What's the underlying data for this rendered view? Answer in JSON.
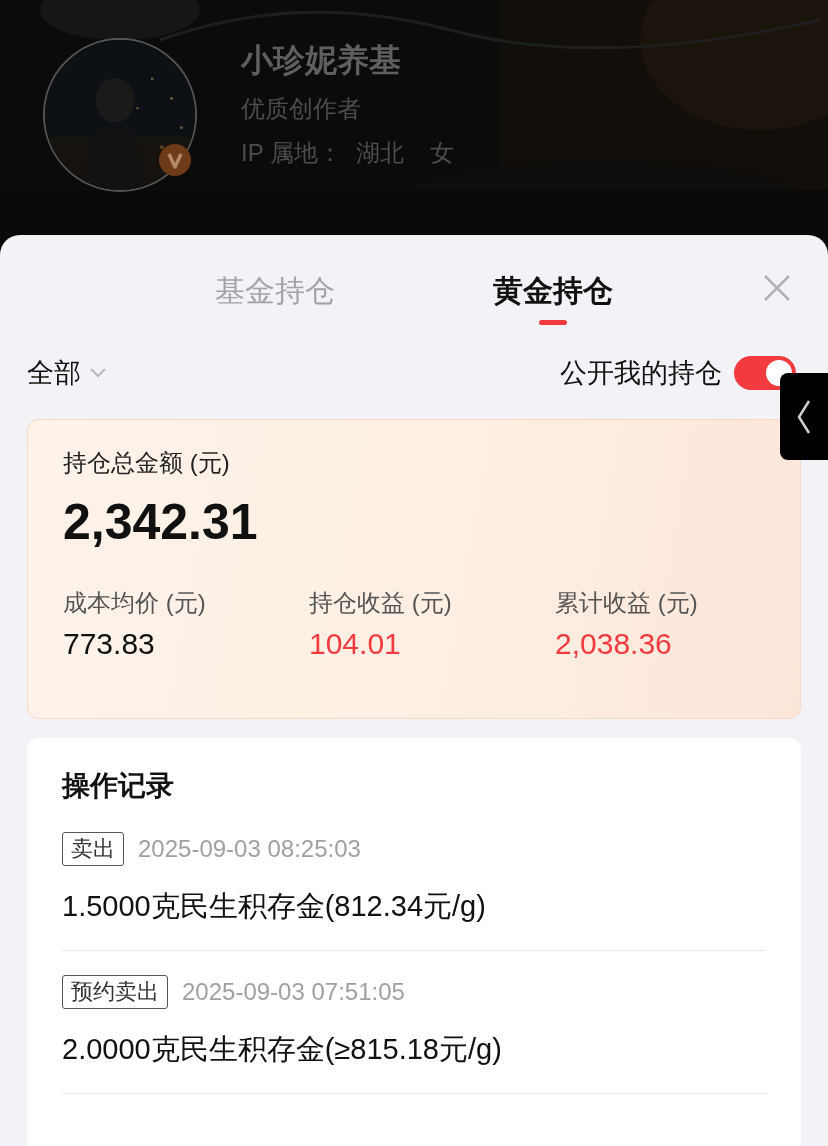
{
  "profile": {
    "name": "小珍妮养基",
    "title": "优质创作者",
    "ip_label": "IP 属地：",
    "region": "湖北",
    "gender": "女",
    "verified": true
  },
  "sheet": {
    "tabs": [
      {
        "label": "基金持仓",
        "selected": false
      },
      {
        "label": "黄金持仓",
        "selected": true
      }
    ],
    "filter": {
      "label": "全部"
    },
    "public_toggle": {
      "label": "公开我的持仓",
      "on": true
    },
    "summary": {
      "total_label": "持仓总金额 (元)",
      "total": "2,342.31",
      "stats": [
        {
          "label": "成本均价 (元)",
          "value": "773.83",
          "color": "#111111"
        },
        {
          "label": "持仓收益 (元)",
          "value": "104.01",
          "color": "#f23a3f"
        },
        {
          "label": "累计收益 (元)",
          "value": "2,038.36",
          "color": "#f23a3f"
        }
      ]
    },
    "records": {
      "title": "操作记录",
      "items": [
        {
          "tag": "卖出",
          "time": "2025-09-03 08:25:03",
          "detail": "1.5000克民生积存金(812.34元/g)"
        },
        {
          "tag": "预约卖出",
          "time": "2025-09-03 07:51:05",
          "detail": "2.0000克民生积存金(≥815.18元/g)"
        }
      ]
    }
  }
}
